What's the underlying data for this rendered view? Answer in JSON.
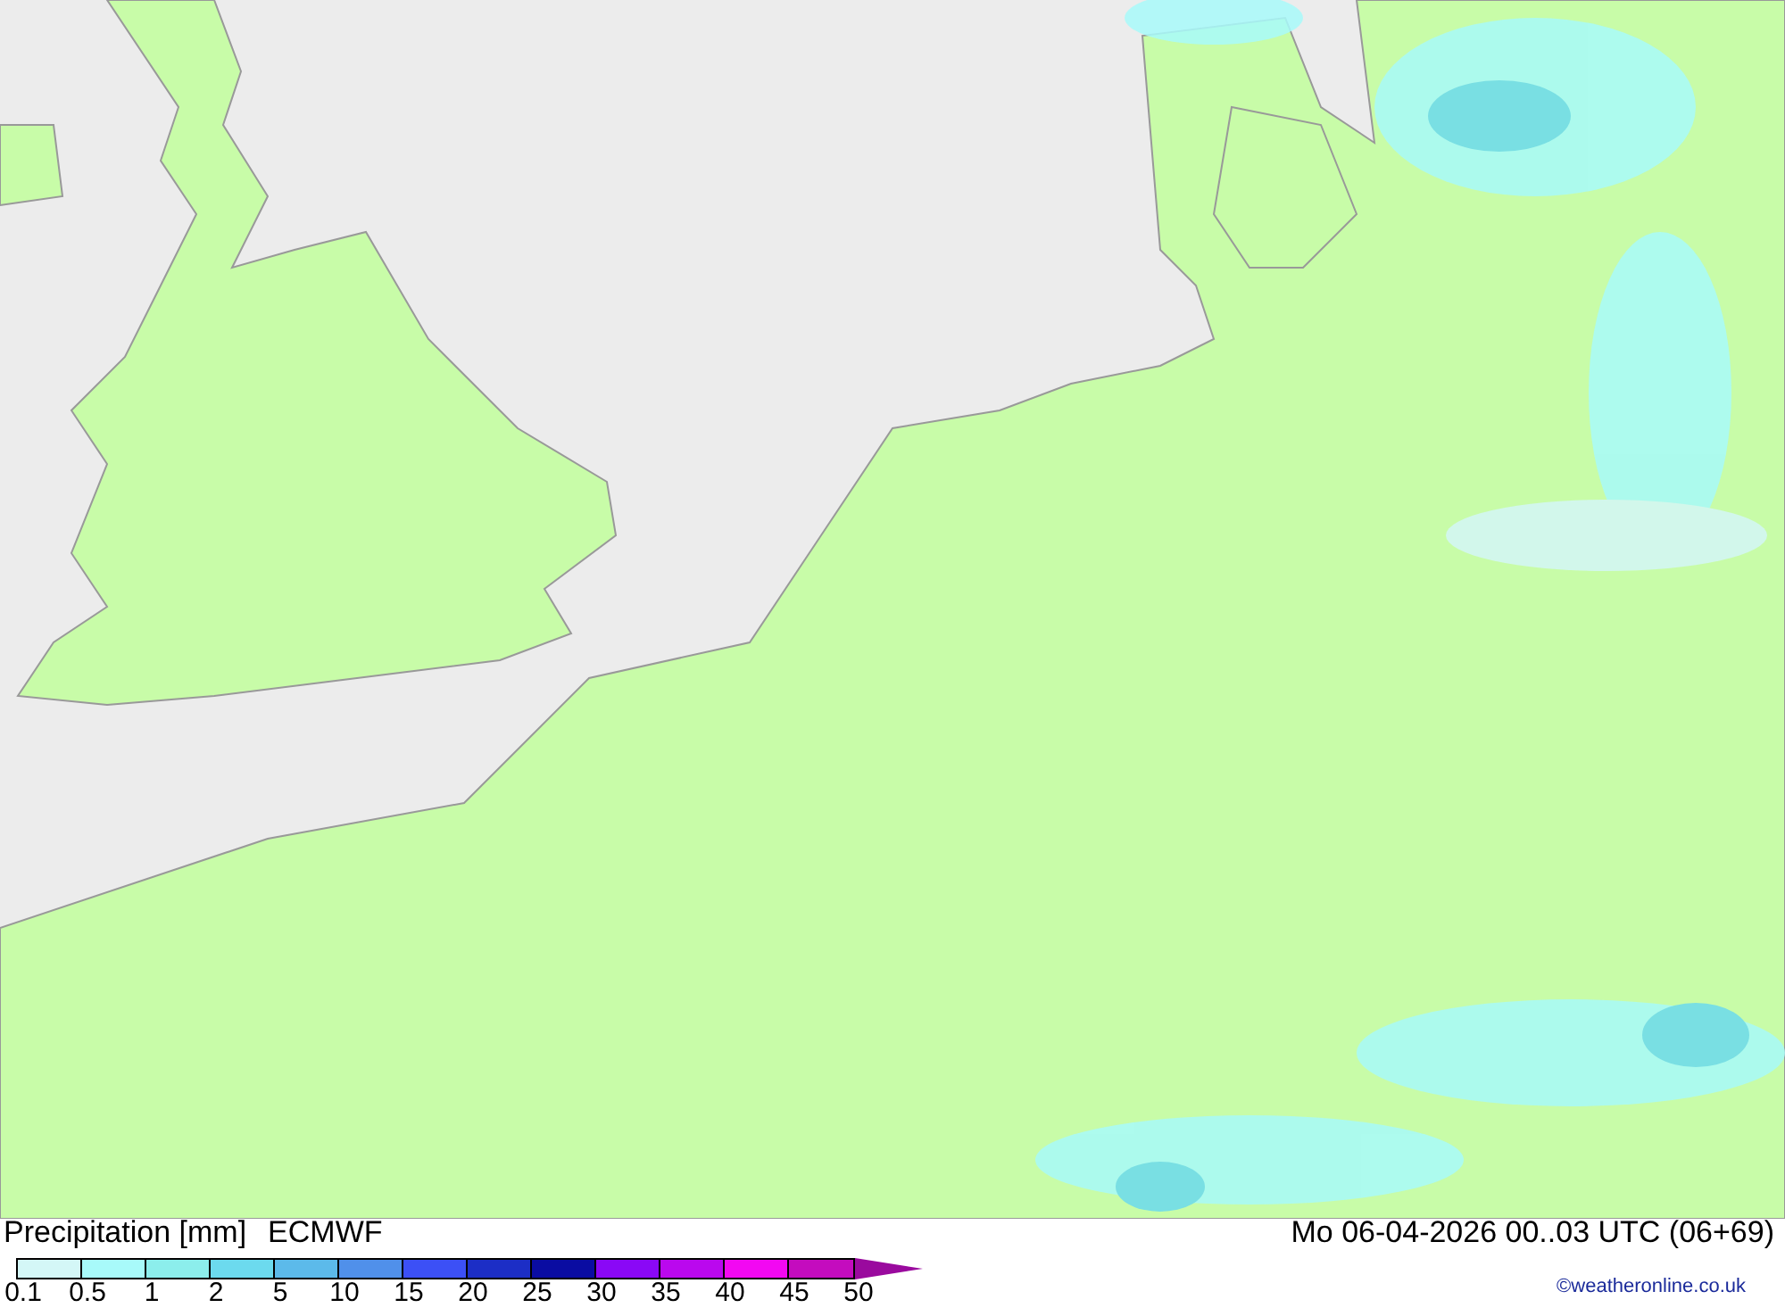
{
  "map": {
    "title": "Precipitation [mm]",
    "model": "ECMWF",
    "valid_time": "Mo 06-04-2026 00..03 UTC (06+69)"
  },
  "legend": {
    "swatches": [
      {
        "color": "#d4f7f7"
      },
      {
        "color": "#a8fafa"
      },
      {
        "color": "#8ceeec"
      },
      {
        "color": "#6cdaee"
      },
      {
        "color": "#5cbaea"
      },
      {
        "color": "#5090ea"
      },
      {
        "color": "#3c50f6"
      },
      {
        "color": "#1c2ec6"
      },
      {
        "color": "#0a0ca2"
      },
      {
        "color": "#8a08f6"
      },
      {
        "color": "#ba08ee"
      },
      {
        "color": "#f208f2"
      },
      {
        "color": "#c40cbe"
      },
      {
        "kind": "arrow",
        "color": "#9a0a9e"
      }
    ],
    "labels": [
      "0.1",
      "0.5",
      "1",
      "2",
      "5",
      "10",
      "15",
      "20",
      "25",
      "30",
      "35",
      "40",
      "45",
      "50"
    ]
  },
  "credit": "©weatheronline.co.uk"
}
